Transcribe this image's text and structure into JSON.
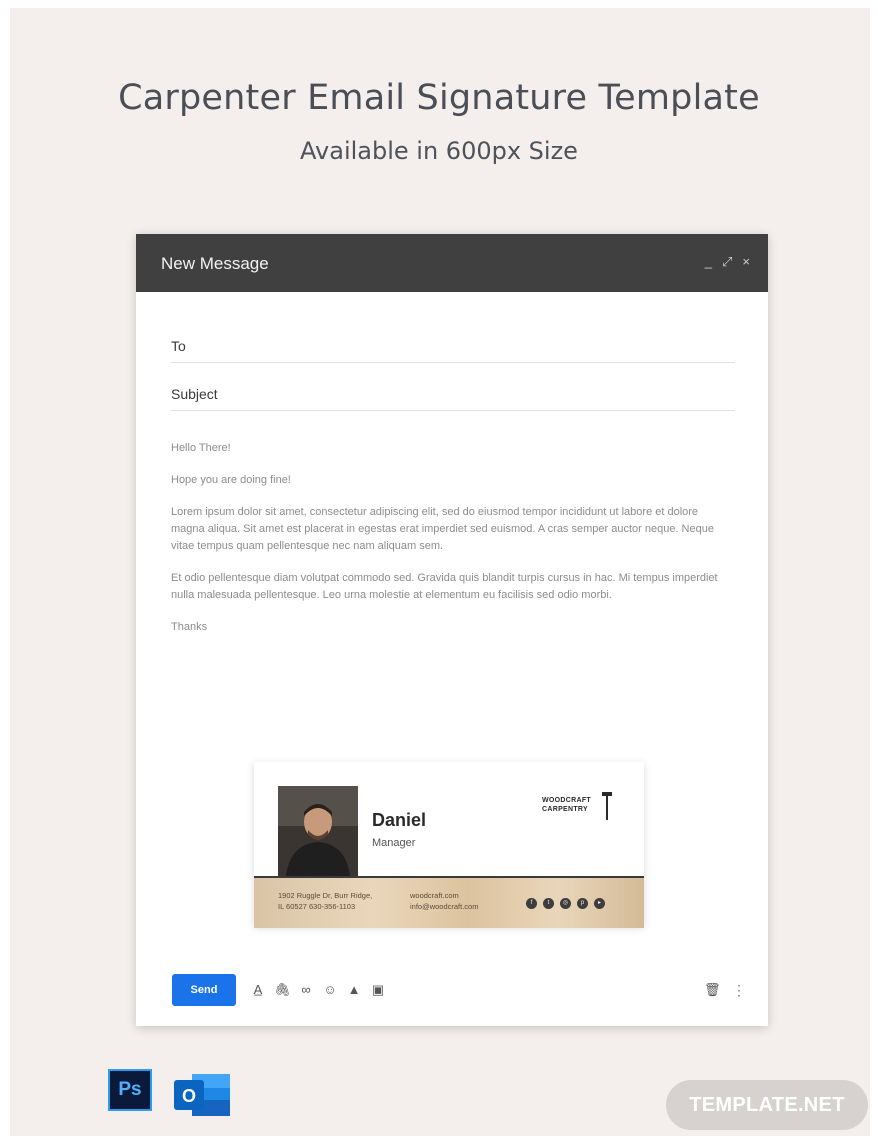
{
  "page": {
    "title": "Carpenter Email Signature Template",
    "subtitle": "Available in 600px Size"
  },
  "window": {
    "title": "New Message",
    "controls": [
      "_",
      "⤢",
      "×"
    ],
    "to_label": "To",
    "subject_label": "Subject",
    "body": [
      "Hello There!",
      "Hope you are doing fine!",
      "Lorem ipsum dolor sit amet, consectetur adipiscing elit, sed do eiusmod tempor incididunt ut labore et dolore magna aliqua. Sit amet est placerat in egestas erat imperdiet sed euismod. A cras semper auctor neque. Neque vitae tempus quam pellentesque nec nam aliquam sem.",
      "Et odio pellentesque diam volutpat commodo sed. Gravida quis blandit turpis cursus in hac. Mi tempus imperdiet nulla malesuada pellentesque. Leo urna molestie at elementum eu facilisis sed odio morbi.",
      "Thanks"
    ]
  },
  "signature": {
    "name": "Daniel",
    "role": "Manager",
    "brand_line1": "WOODCRAFT",
    "brand_line2": "CARPENTRY",
    "address_line1": "1902 Ruggle Dr, Burr Ridge,",
    "address_line2": "IL 60527 630-356-1103",
    "web": "woodcraft.com",
    "email": "info@woodcraft.com",
    "socials": [
      "facebook-icon",
      "twitter-icon",
      "instagram-icon",
      "pinterest-icon",
      "youtube-icon"
    ]
  },
  "toolbar": {
    "send_label": "Send",
    "tools": [
      "format-text-icon",
      "attach-icon",
      "link-icon",
      "emoji-icon",
      "drive-icon",
      "photo-icon"
    ]
  },
  "badges": {
    "ps_label": "Ps",
    "outlook_label": "O",
    "template_brand": "TEMPLATE.NET"
  },
  "colors": {
    "header_bg": "#404040",
    "send_blue": "#1a73e8",
    "poster_bg": "#f4efec"
  }
}
